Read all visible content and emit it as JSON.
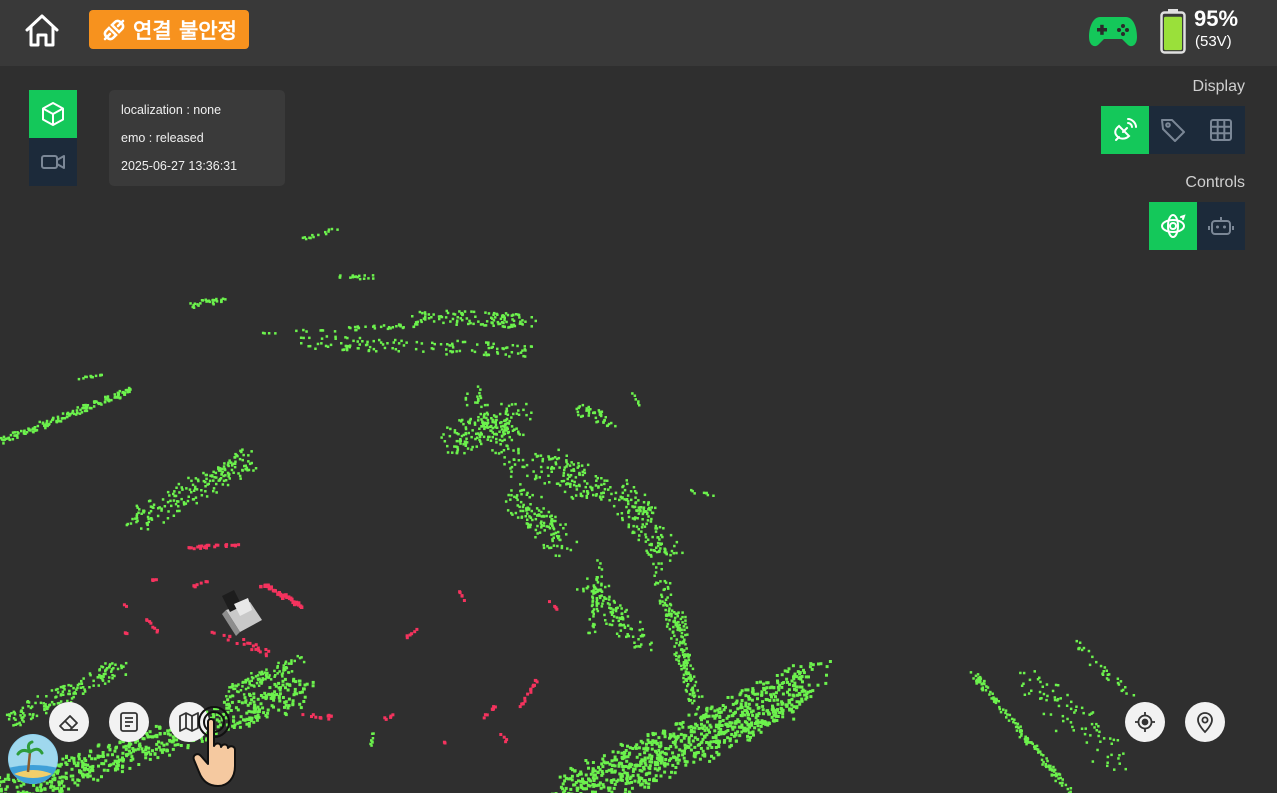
{
  "header": {
    "connection_label": "연결 불안정",
    "battery_percent": "95%",
    "battery_voltage": "(53V)",
    "battery_level": 0.95
  },
  "colors": {
    "accent_green": "#14c85a",
    "warning_orange": "#f7921e",
    "inactive_button": "#1c2a3a",
    "lidar_points": "#6cf24d",
    "obstacle_points": "#f5335e"
  },
  "info": {
    "localization": "localization : none",
    "emo": "emo : released",
    "timestamp": "2025-06-27 13:36:31"
  },
  "display": {
    "label": "Display",
    "buttons": [
      "satellite-icon",
      "tag-icon",
      "grid-icon"
    ]
  },
  "controls": {
    "label": "Controls",
    "buttons": [
      "orbit-icon",
      "robot-icon"
    ]
  },
  "view_toggle": [
    "cube-icon",
    "video-camera-icon"
  ],
  "bottom_tools": [
    "eraser-icon",
    "notes-icon",
    "map-icon",
    "locate-icon",
    "map-pin-icon"
  ]
}
